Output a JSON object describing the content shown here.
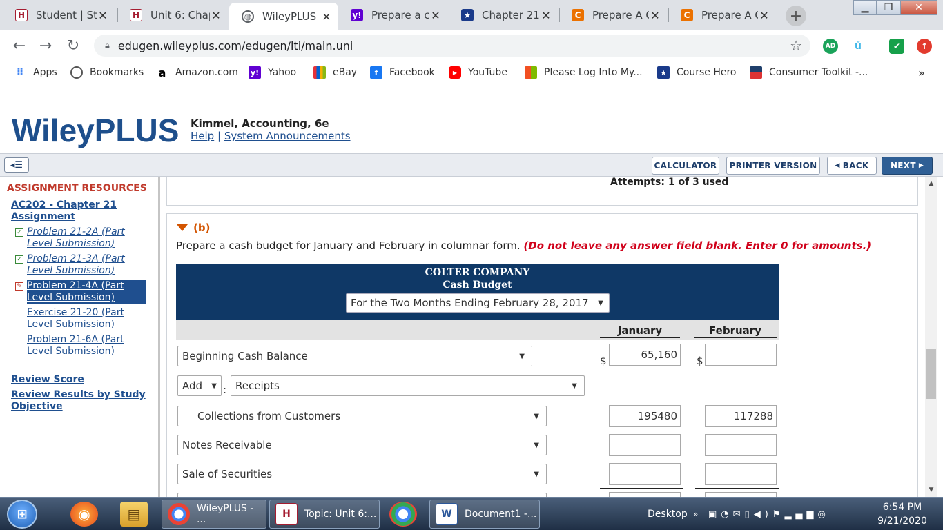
{
  "browser": {
    "tabs": [
      {
        "label": "Student | St",
        "icon": "harvard-shield-icon",
        "active": false
      },
      {
        "label": "Unit 6: Chap",
        "icon": "harvard-shield-icon",
        "active": false
      },
      {
        "label": "WileyPLUS",
        "icon": "globe-icon",
        "active": true
      },
      {
        "label": "Prepare a ca",
        "icon": "yahoo-icon",
        "active": false
      },
      {
        "label": "Chapter 21",
        "icon": "star-icon",
        "active": false
      },
      {
        "label": "Prepare A C",
        "icon": "chegg-icon",
        "active": false
      },
      {
        "label": "Prepare A C",
        "icon": "chegg-icon",
        "active": false
      }
    ],
    "url": "edugen.wileyplus.com/edugen/lti/main.uni",
    "bookmarks": [
      {
        "label": "Apps",
        "icon": "apps-grid-icon"
      },
      {
        "label": "Bookmarks",
        "icon": "globe-icon"
      },
      {
        "label": "Amazon.com",
        "icon": "amazon-icon"
      },
      {
        "label": "Yahoo",
        "icon": "yahoo-icon"
      },
      {
        "label": "eBay",
        "icon": "shopping-bag-icon"
      },
      {
        "label": "Facebook",
        "icon": "facebook-icon"
      },
      {
        "label": "YouTube",
        "icon": "youtube-icon"
      },
      {
        "label": "Please Log Into My...",
        "icon": "windows-logo-icon"
      },
      {
        "label": "Course Hero",
        "icon": "star-icon"
      },
      {
        "label": "Consumer Toolkit -...",
        "icon": "flag-icon"
      }
    ],
    "bookmarks_overflow": "»"
  },
  "header": {
    "logo": "WileyPLUS",
    "course": "Kimmel, Accounting, 6e",
    "help": "Help",
    "separator": "|",
    "announcements": "System Announcements"
  },
  "actions": {
    "calculator": "CALCULATOR",
    "printer": "PRINTER VERSION",
    "back": "BACK",
    "next": "NEXT"
  },
  "sidebar": {
    "heading": "ASSIGNMENT RESOURCES",
    "assignment": "AC202 - Chapter 21 Assignment",
    "items": [
      {
        "label": "Problem 21-2A (Part Level Submission)",
        "status": "done"
      },
      {
        "label": "Problem 21-3A (Part Level Submission)",
        "status": "done"
      },
      {
        "label": "Problem 21-4A (Part Level Submission)",
        "status": "current"
      },
      {
        "label": "Exercise 21-20 (Part Level Submission)",
        "status": "none"
      },
      {
        "label": "Problem 21-6A (Part Level Submission)",
        "status": "none"
      }
    ],
    "review_score": "Review Score",
    "review_results": "Review Results by Study Objective"
  },
  "content": {
    "attempts": "Attempts: 1 of 3 used",
    "part": "(b)",
    "instruction": "Prepare a cash budget for January and February in columnar form.",
    "warning": "(Do not leave any answer field blank. Enter 0 for amounts.)",
    "company": "COLTER COMPANY",
    "statement": "Cash Budget",
    "period": "For the Two Months Ending February 28, 2017",
    "col_jan": "January",
    "col_feb": "February",
    "currency": "$",
    "rows": [
      {
        "label": "Beginning Cash Balance",
        "jan": "65,160",
        "feb": ""
      },
      {
        "label": "Receipts",
        "prefix": "Add",
        "jan": null,
        "feb": null
      },
      {
        "label": "Collections from Customers",
        "jan": "195480",
        "feb": "117288"
      },
      {
        "label": "Notes Receivable",
        "jan": "",
        "feb": ""
      },
      {
        "label": "Sale of Securities",
        "jan": "",
        "feb": ""
      }
    ]
  },
  "taskbar": {
    "windows": [
      {
        "label": "WileyPLUS - ...",
        "icon": "chrome-icon"
      },
      {
        "label": "Topic: Unit 6:...",
        "icon": "harvard-shield-icon"
      },
      {
        "label": "Document1 -...",
        "icon": "word-document-icon"
      }
    ],
    "desktop": "Desktop",
    "time": "6:54 PM",
    "date": "9/21/2020"
  }
}
